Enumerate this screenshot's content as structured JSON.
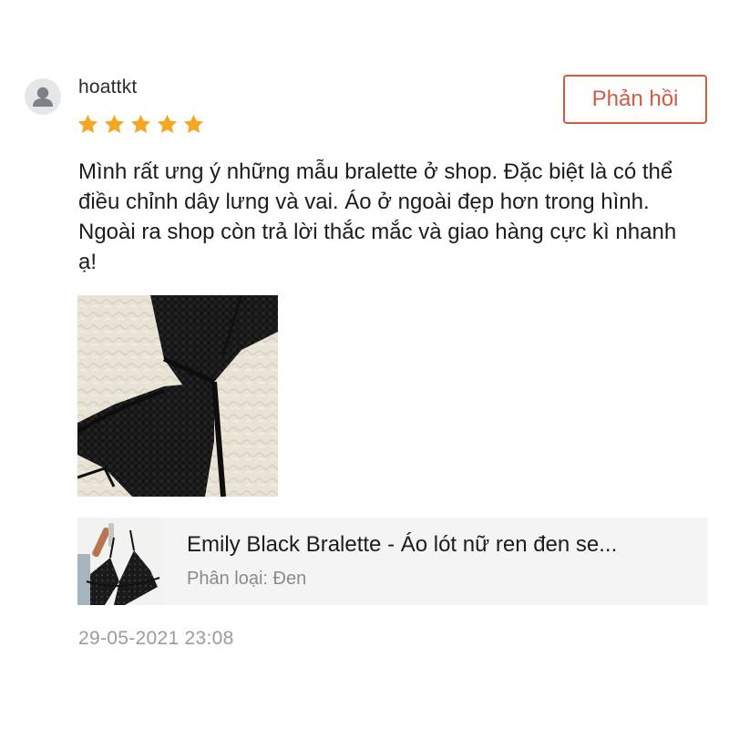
{
  "review": {
    "username": "hoattkt",
    "rating": 5,
    "rating_max": 5,
    "reply_button_label": "Phản hồi",
    "text": "Mình rất ưng ý những mẫu bralette ở shop. Đặc biệt là có thể điều chỉnh dây lưng và vai. Áo ở ngoài đẹp hơn trong hình. Ngoài ra shop còn trả lời thắc mắc và giao hàng cực kì nhanh ạ!",
    "timestamp": "29-05-2021 23:08"
  },
  "product": {
    "name": "Emily Black Bralette - Áo lót nữ ren đen se...",
    "variant_label": "Phân loại:",
    "variant_value": "Đen"
  },
  "colors": {
    "accent": "#d05a43",
    "star": "#f5a623",
    "card_background": "#f4f4f4",
    "muted_text": "#9b9b9b"
  },
  "icons": {
    "avatar": "user-silhouette-icon",
    "rating": "star-icon"
  }
}
